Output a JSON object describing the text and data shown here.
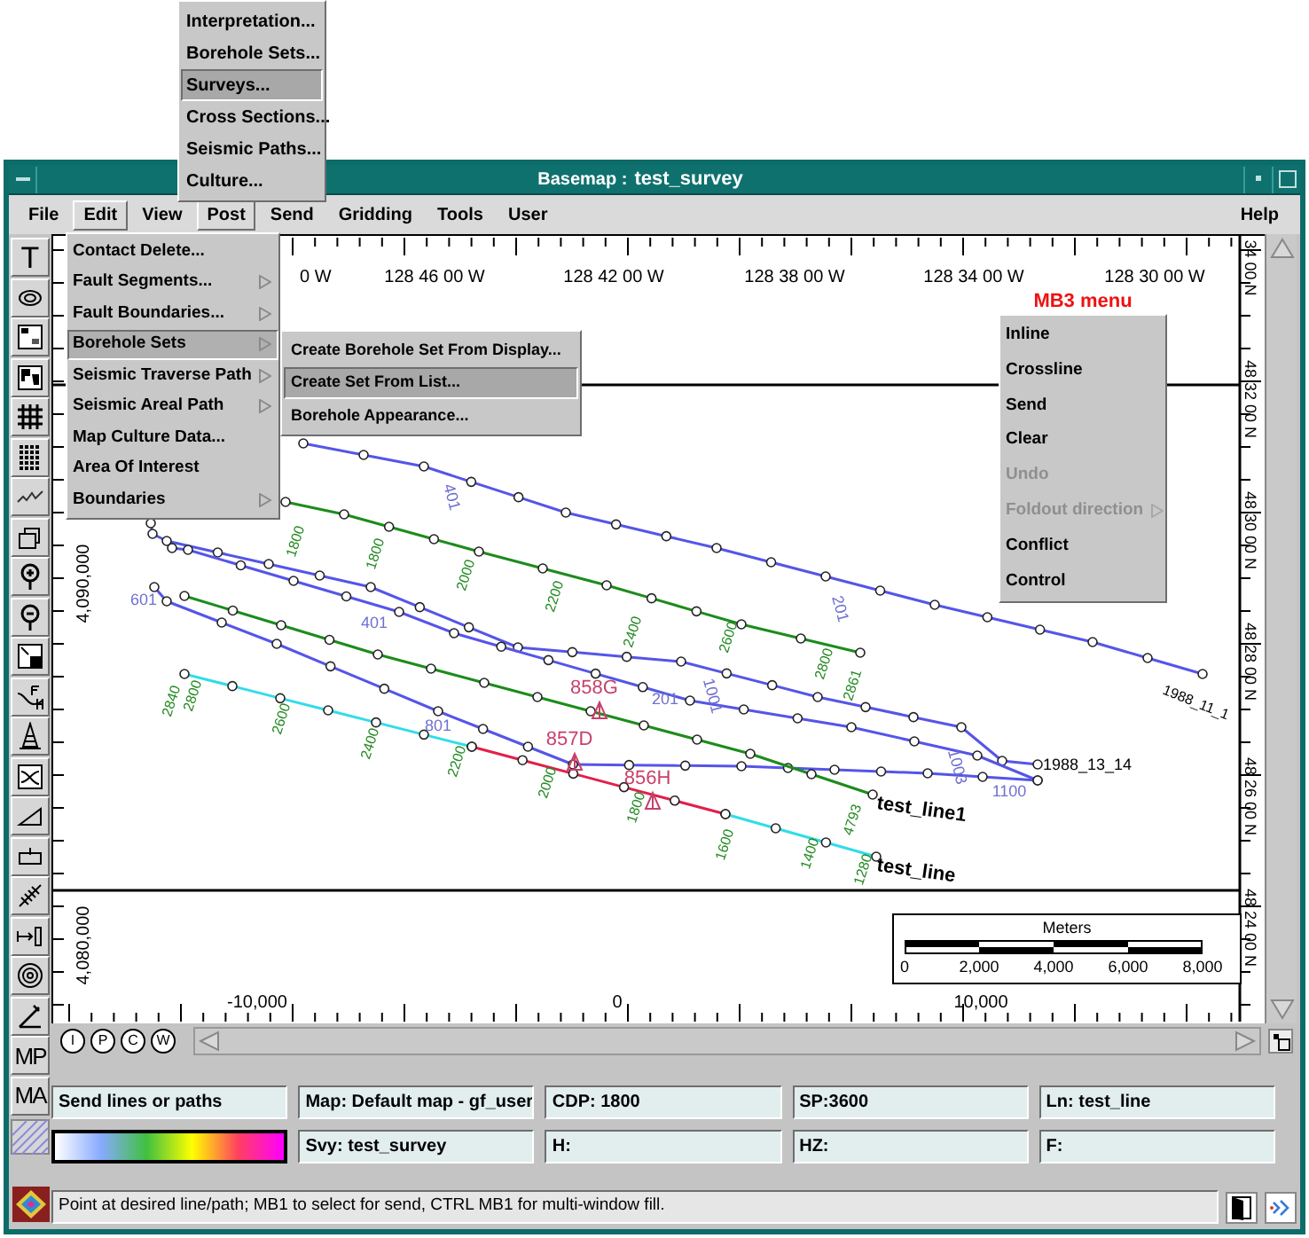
{
  "post_menu": {
    "items": [
      {
        "label": "Interpretation...",
        "selected": false
      },
      {
        "label": "Borehole Sets...",
        "selected": false
      },
      {
        "label": "Surveys...",
        "selected": true
      },
      {
        "label": "Cross Sections...",
        "selected": false
      },
      {
        "label": "Seismic Paths...",
        "selected": false
      },
      {
        "label": "Culture...",
        "selected": false
      }
    ]
  },
  "window": {
    "title": "Basemap :",
    "survey": "test_survey"
  },
  "menubar": {
    "items": [
      {
        "label": "File",
        "selected": false
      },
      {
        "label": "Edit",
        "selected": true
      },
      {
        "label": "View",
        "selected": false
      },
      {
        "label": "Post",
        "selected": true
      },
      {
        "label": "Send",
        "selected": false
      },
      {
        "label": "Gridding",
        "selected": false
      },
      {
        "label": "Tools",
        "selected": false
      },
      {
        "label": "User",
        "selected": false
      }
    ],
    "help": "Help"
  },
  "edit_menu": {
    "items": [
      {
        "label": "Contact Delete...",
        "submenu": false,
        "selected": false
      },
      {
        "label": "Fault Segments...",
        "submenu": true,
        "selected": false
      },
      {
        "label": "Fault Boundaries...",
        "submenu": true,
        "selected": false
      },
      {
        "label": "Borehole Sets",
        "submenu": true,
        "selected": true
      },
      {
        "label": "Seismic Traverse Path",
        "submenu": true,
        "selected": false
      },
      {
        "label": "Seismic Areal Path",
        "submenu": true,
        "selected": false
      },
      {
        "label": "Map Culture Data...",
        "submenu": false,
        "selected": false
      },
      {
        "label": "Area Of Interest",
        "submenu": false,
        "selected": false
      },
      {
        "label": "Boundaries",
        "submenu": true,
        "selected": false
      }
    ]
  },
  "borehole_submenu": {
    "items": [
      {
        "label": "Create Borehole Set From Display...",
        "selected": false
      },
      {
        "label": "Create Set From List...",
        "selected": true
      },
      {
        "label": "Borehole Appearance...",
        "selected": false
      }
    ]
  },
  "mb3_menu": {
    "title": "MB3 menu",
    "items": [
      {
        "label": "Inline",
        "disabled": false,
        "submenu": false
      },
      {
        "label": "Crossline",
        "disabled": false,
        "submenu": false
      },
      {
        "label": "Send",
        "disabled": false,
        "submenu": false
      },
      {
        "label": "Clear",
        "disabled": false,
        "submenu": false
      },
      {
        "label": "Undo",
        "disabled": true,
        "submenu": false
      },
      {
        "label": "Foldout direction",
        "disabled": true,
        "submenu": true
      },
      {
        "label": "Conflict",
        "disabled": false,
        "submenu": false
      },
      {
        "label": "Control",
        "disabled": false,
        "submenu": false
      }
    ]
  },
  "toolbar": [
    {
      "kind": "text",
      "label": "T"
    },
    {
      "kind": "contour"
    },
    {
      "kind": "legend"
    },
    {
      "kind": "world"
    },
    {
      "kind": "grid"
    },
    {
      "kind": "dots"
    },
    {
      "kind": "wave"
    },
    {
      "kind": "frames"
    },
    {
      "kind": "zoom_in"
    },
    {
      "kind": "zoom_out"
    },
    {
      "kind": "resize"
    },
    {
      "kind": "fault"
    },
    {
      "kind": "derrick"
    },
    {
      "kind": "crossing"
    },
    {
      "kind": "triangle"
    },
    {
      "kind": "pin"
    },
    {
      "kind": "hatch_pencil"
    },
    {
      "kind": "arrow_bar"
    },
    {
      "kind": "concentric"
    },
    {
      "kind": "pencil"
    },
    {
      "kind": "text",
      "label": "MP"
    },
    {
      "kind": "text",
      "label": "MA"
    }
  ],
  "map": {
    "top_axis": [
      "0 W",
      "128 46 00 W",
      "128 42 00 W",
      "128 38 00 W",
      "128 34 00 W",
      "128 30 00 W"
    ],
    "right_axis": [
      "34 00 N",
      "48 32 00 N",
      "48 30 00 N",
      "48 28 00 N",
      "48 26 00 N",
      "48 24 00 N"
    ],
    "left_axis": [
      "4,090,000",
      "4,080,000"
    ],
    "bottom_axis": [
      "-10,000",
      "0",
      "10,000"
    ],
    "labels": [
      {
        "text": "1800",
        "kind": "shotpoint"
      },
      {
        "text": "1800",
        "kind": "shotpoint"
      },
      {
        "text": "2000",
        "kind": "shotpoint"
      },
      {
        "text": "2200",
        "kind": "shotpoint"
      },
      {
        "text": "2400",
        "kind": "shotpoint"
      },
      {
        "text": "2600",
        "kind": "shotpoint"
      },
      {
        "text": "2800",
        "kind": "shotpoint"
      },
      {
        "text": "2861",
        "kind": "shotpoint"
      },
      {
        "text": "2840",
        "kind": "shotpoint"
      },
      {
        "text": "2800",
        "kind": "shotpoint"
      },
      {
        "text": "2600",
        "kind": "shotpoint"
      },
      {
        "text": "2400",
        "kind": "shotpoint"
      },
      {
        "text": "2200",
        "kind": "shotpoint"
      },
      {
        "text": "2000",
        "kind": "shotpoint"
      },
      {
        "text": "1800",
        "kind": "shotpoint"
      },
      {
        "text": "1600",
        "kind": "shotpoint"
      },
      {
        "text": "1400",
        "kind": "shotpoint"
      },
      {
        "text": "1280",
        "kind": "shotpoint"
      },
      {
        "text": "4793",
        "kind": "shotpoint"
      },
      {
        "text": "401",
        "kind": "path_point_rotated"
      },
      {
        "text": "201",
        "kind": "path_point_rotated"
      },
      {
        "text": "601",
        "kind": "path_point"
      },
      {
        "text": "401",
        "kind": "path_point"
      },
      {
        "text": "801",
        "kind": "path_point"
      },
      {
        "text": "201",
        "kind": "path_point"
      },
      {
        "text": "1001",
        "kind": "path_point_rotated"
      },
      {
        "text": "1003",
        "kind": "path_point_rotated"
      },
      {
        "text": "1100",
        "kind": "path_point"
      },
      {
        "text": "858G",
        "kind": "well"
      },
      {
        "text": "857D",
        "kind": "well"
      },
      {
        "text": "856H",
        "kind": "well"
      },
      {
        "text": "test_line1",
        "kind": "line"
      },
      {
        "text": "test_line",
        "kind": "line"
      },
      {
        "text": "1988_13_14",
        "kind": "path_name"
      },
      {
        "text": "1988_11_1",
        "kind": "path_name_rotated"
      }
    ],
    "scale_bar": {
      "title": "Meters",
      "ticks": [
        "0",
        "2,000",
        "4,000",
        "6,000",
        "8,000"
      ]
    }
  },
  "scroll_buttons": [
    "I",
    "P",
    "C",
    "W"
  ],
  "status_fields": [
    {
      "kind": "text",
      "text": "Send lines or paths"
    },
    {
      "kind": "text",
      "text": "Map: Default map - gf_user"
    },
    {
      "kind": "text",
      "text": "CDP: 1800"
    },
    {
      "kind": "text",
      "text": "SP:3600"
    },
    {
      "kind": "text",
      "text": "Ln: test_line"
    },
    {
      "kind": "color_bar"
    },
    {
      "kind": "text",
      "text": "Svy: test_survey"
    },
    {
      "kind": "text",
      "text": "H:"
    },
    {
      "kind": "text",
      "text": "HZ:"
    },
    {
      "kind": "text",
      "text": "F:"
    }
  ],
  "message": "Point at desired line/path; MB1 to select for send, CTRL MB1 for multi-window fill."
}
